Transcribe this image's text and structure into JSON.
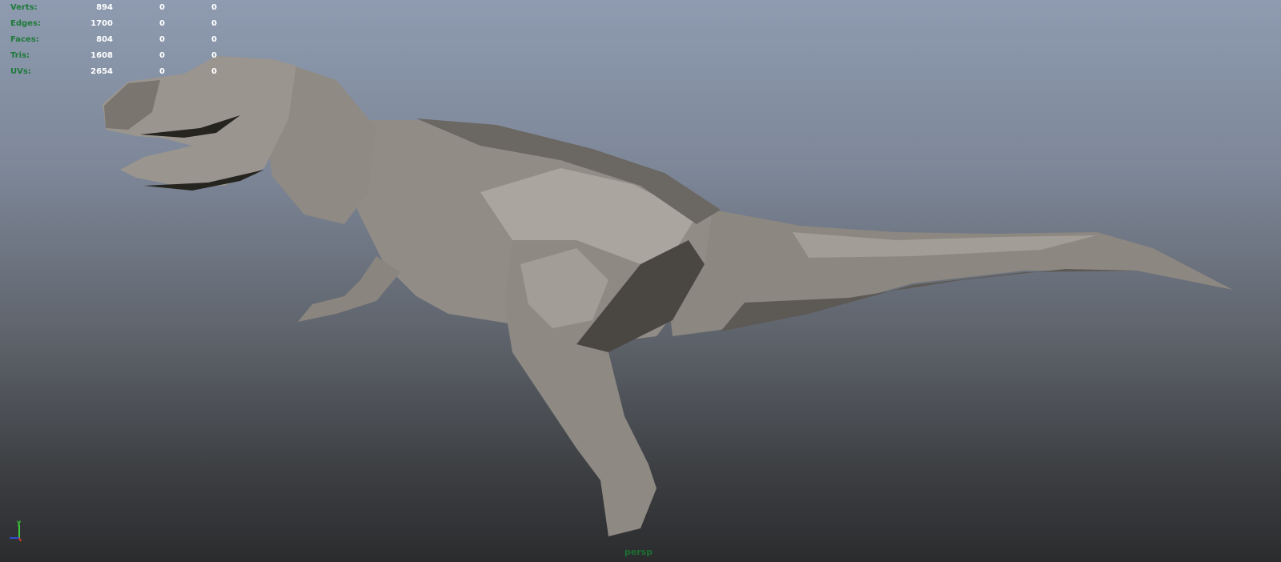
{
  "hud": {
    "rows": [
      {
        "label": "Verts:",
        "v1": "894",
        "v2": "0",
        "v3": "0"
      },
      {
        "label": "Edges:",
        "v1": "1700",
        "v2": "0",
        "v3": "0"
      },
      {
        "label": "Faces:",
        "v1": "804",
        "v2": "0",
        "v3": "0"
      },
      {
        "label": "Tris:",
        "v1": "1608",
        "v2": "0",
        "v3": "0"
      },
      {
        "label": "UVs:",
        "v1": "2654",
        "v2": "0",
        "v3": "0"
      }
    ]
  },
  "camera": {
    "name": "persp"
  },
  "axis": {
    "y_label": "y",
    "colors": {
      "x": "#d23c2c",
      "y": "#3cc83c",
      "z": "#2c4cd2"
    }
  },
  "colors": {
    "hud_label": "#1f7a3a",
    "hud_value": "#ffffff",
    "model_base": "#8f8a84"
  }
}
